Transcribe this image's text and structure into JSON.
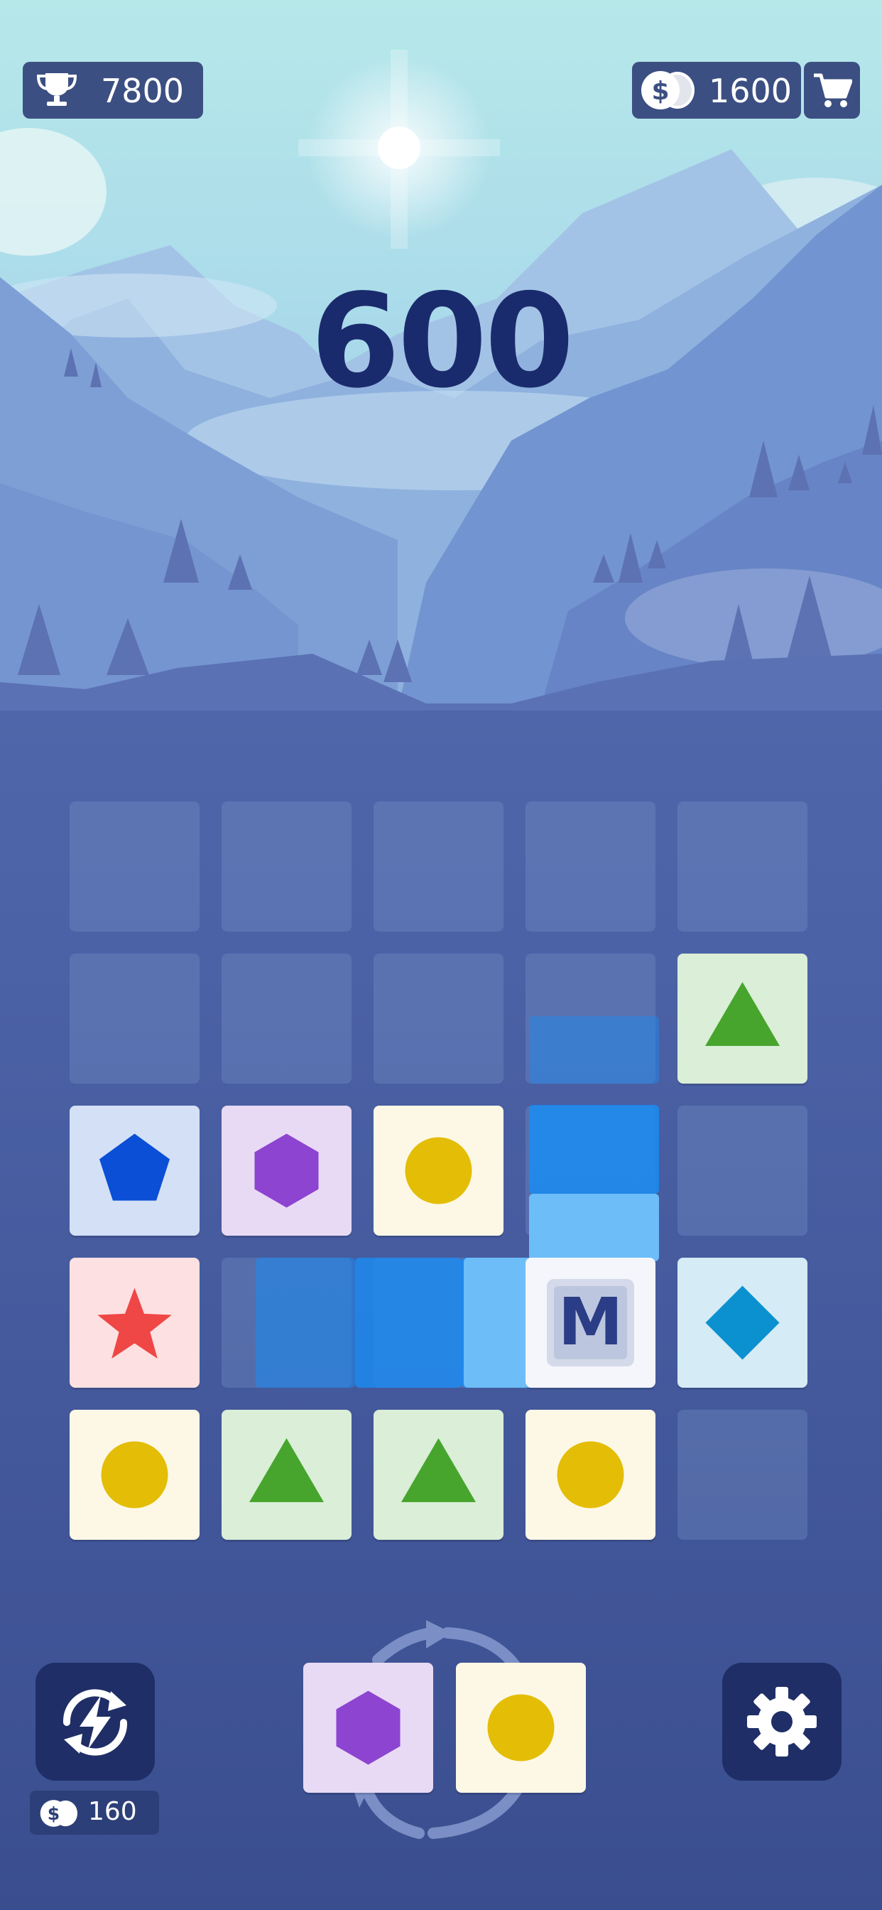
{
  "hud": {
    "best_score": "7800",
    "coins": "1600",
    "score": "600"
  },
  "icons": {
    "trophy": "trophy-icon",
    "coins": "coins-icon",
    "cart": "cart-icon",
    "boost": "lightning-refresh-icon",
    "settings": "gear-icon",
    "swap": "swap-arrows-icon"
  },
  "board": {
    "rows": 5,
    "cols": 5,
    "tiles": [
      {
        "row": 1,
        "col": 4,
        "shape": "triangle",
        "color": "#47a52e",
        "bg": "#dbeed8"
      },
      {
        "row": 2,
        "col": 0,
        "shape": "pentagon",
        "color": "#0a4fd6",
        "bg": "#d3e0f6"
      },
      {
        "row": 2,
        "col": 1,
        "shape": "hexagon",
        "color": "#8d44d0",
        "bg": "#e8daf4"
      },
      {
        "row": 2,
        "col": 2,
        "shape": "circle",
        "color": "#e4bd07",
        "bg": "#fdf8e6"
      },
      {
        "row": 3,
        "col": 0,
        "shape": "star",
        "color": "#ef4646",
        "bg": "#fde0e1"
      },
      {
        "row": 3,
        "col": 3,
        "shape": "m-block",
        "color": "#2a3d86",
        "bg": "#f5f6fb",
        "letter": "M"
      },
      {
        "row": 3,
        "col": 4,
        "shape": "diamond",
        "color": "#0b91cf",
        "bg": "#d5ebf6"
      },
      {
        "row": 4,
        "col": 0,
        "shape": "circle",
        "color": "#e4bd07",
        "bg": "#fdf8e6"
      },
      {
        "row": 4,
        "col": 1,
        "shape": "triangle",
        "color": "#47a52e",
        "bg": "#dbeed8"
      },
      {
        "row": 4,
        "col": 2,
        "shape": "triangle",
        "color": "#47a52e",
        "bg": "#dbeed8"
      },
      {
        "row": 4,
        "col": 3,
        "shape": "circle",
        "color": "#e4bd07",
        "bg": "#fdf8e6"
      }
    ]
  },
  "next_pieces": [
    {
      "shape": "hexagon",
      "color": "#8d44d0",
      "bg": "#e8daf4"
    },
    {
      "shape": "circle",
      "color": "#e4bd07",
      "bg": "#fdf8e6"
    }
  ],
  "boost": {
    "cost": "160"
  },
  "colors": {
    "hud_pill": "#3c4f82",
    "score_text": "#1a2b6d",
    "button_dark": "#1f2e66",
    "trail_blue": "#1a8cf2"
  }
}
